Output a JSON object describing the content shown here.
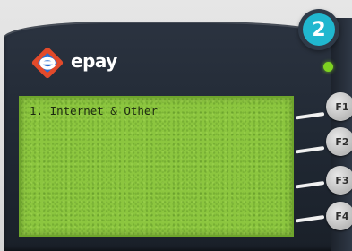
{
  "badge": {
    "step": "2",
    "color": "#20b7cf"
  },
  "brand": {
    "name": "epay",
    "icon": "epay-logo-icon"
  },
  "status": {
    "led_color": "#7ed321"
  },
  "display": {
    "background": "#8cc63f",
    "lines": [
      "1. Internet & Other"
    ]
  },
  "function_keys": [
    {
      "label": "F1"
    },
    {
      "label": "F2"
    },
    {
      "label": "F3"
    },
    {
      "label": "F4"
    }
  ]
}
